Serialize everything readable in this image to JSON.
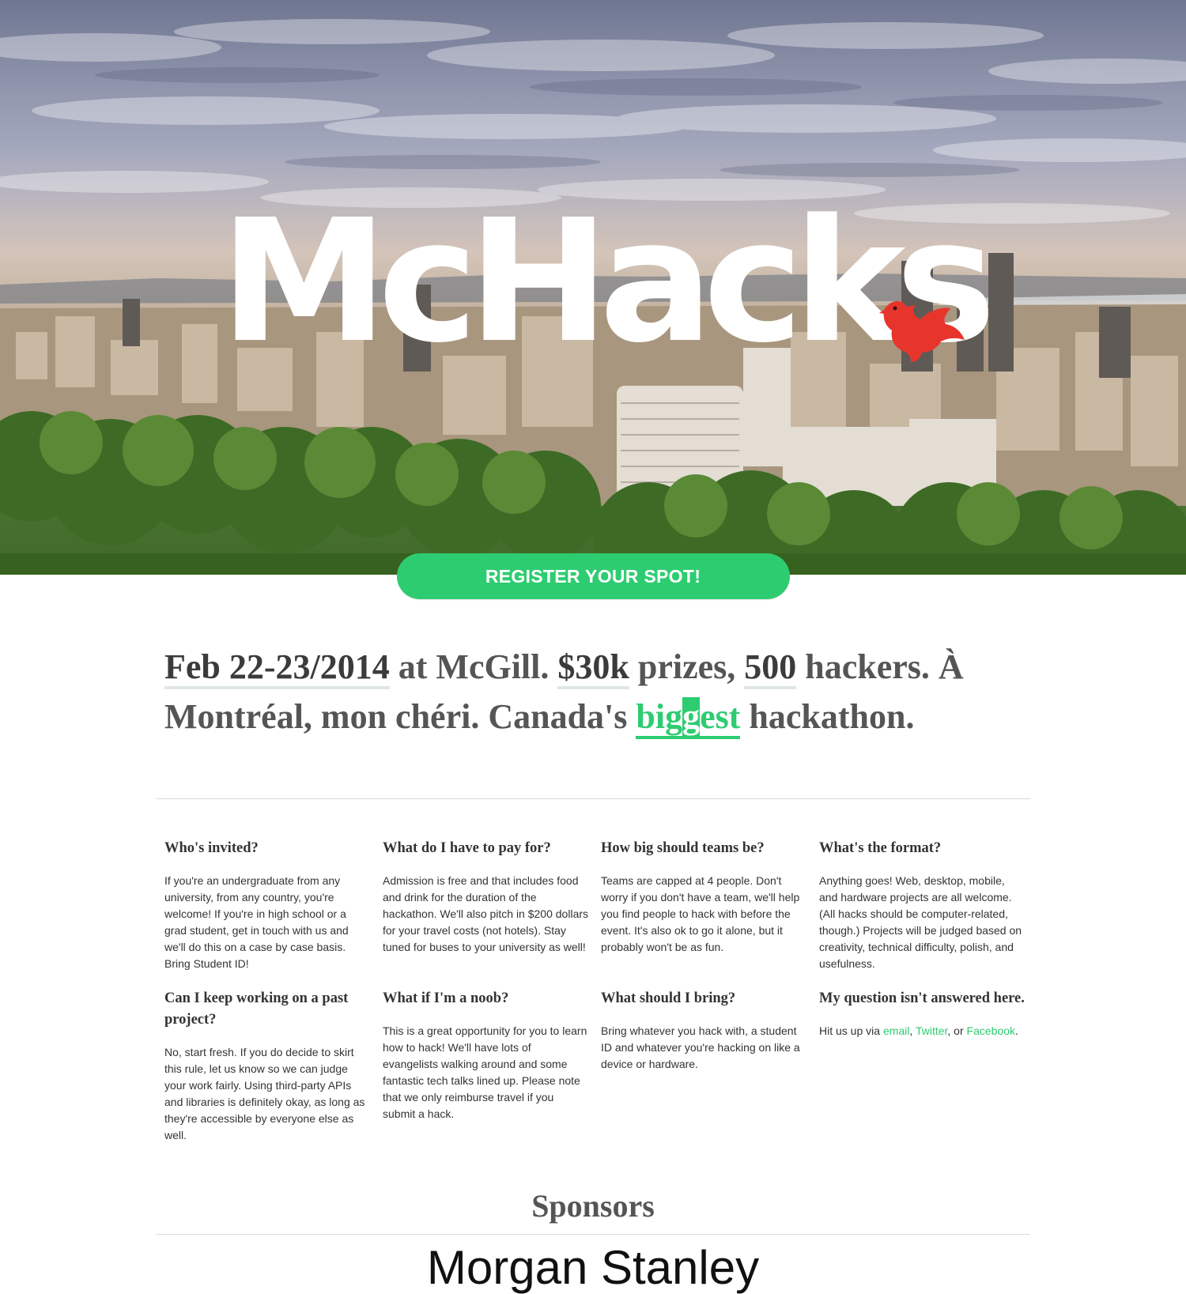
{
  "hero": {
    "title": "McHacks",
    "logo_icon": "bird-icon",
    "register_label": "REGISTER YOUR SPOT!",
    "colors": {
      "accent": "#2ecc71",
      "bird": "#e8352c"
    }
  },
  "tagline": {
    "date": "Feb 22-23/2014",
    "at": " at McGill. ",
    "prize": "$30k",
    "prizes_word": " prizes, ",
    "hackers_count": "500",
    "rest": " hackers. À Montréal, mon chéri. Canada's ",
    "big_a": "big",
    "big_b": "g",
    "big_c": "est",
    "end": " hackathon."
  },
  "faq": {
    "items": [
      {
        "q": "Who's invited?",
        "a": "If you're an undergraduate from any university, from any country, you're welcome! If you're in high school or a grad student, get in touch with us and we'll do this on a case by case basis. Bring Student ID!"
      },
      {
        "q": "What do I have to pay for?",
        "a": "Admission is free and that includes food and drink for the duration of the hackathon. We'll also pitch in $200 dollars for your travel costs (not hotels). Stay tuned for buses to your university as well!"
      },
      {
        "q": "How big should teams be?",
        "a": "Teams are capped at 4 people. Don't worry if you don't have a team, we'll help you find people to hack with before the event. It's also ok to go it alone, but it probably won't be as fun."
      },
      {
        "q": "What's the format?",
        "a": "Anything goes! Web, desktop, mobile, and hardware projects are all welcome. (All hacks should be computer-related, though.) Projects will be judged based on creativity, technical difficulty, polish, and usefulness."
      },
      {
        "q": "Can I keep working on a past project?",
        "a": "No, start fresh. If you do decide to skirt this rule, let us know so we can judge your work fairly. Using third-party APIs and libraries is definitely okay, as long as they're accessible by everyone else as well."
      },
      {
        "q": "What if I'm a noob?",
        "a": "This is a great opportunity for you to learn how to hack! We'll have lots of evangelists walking around and some fantastic tech talks lined up. Please note that we only reimburse travel if you submit a hack."
      },
      {
        "q": "What should I bring?",
        "a": "Bring whatever you hack with, a student ID and whatever you're hacking on like a device or hardware."
      },
      {
        "q": "My question isn't answered here."
      }
    ],
    "contact": {
      "prefix": "Hit us up via ",
      "email": "email",
      "sep1": ", ",
      "twitter": "Twitter",
      "sep2": ", or ",
      "facebook": "Facebook",
      "suffix": "."
    }
  },
  "sponsors": {
    "title": "Sponsors",
    "first_logo": "Morgan Stanley"
  }
}
